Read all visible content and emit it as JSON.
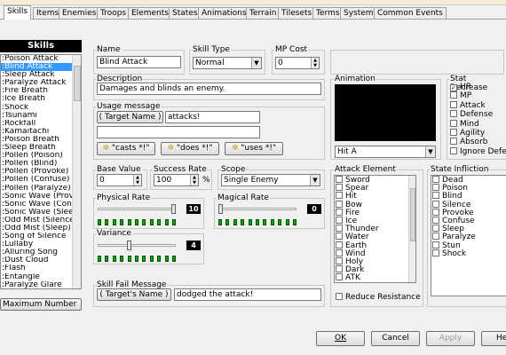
{
  "tabs": [
    "Skills",
    "Items",
    "Enemies",
    "Troops",
    "Elements",
    "States",
    "Animations",
    "Terrain",
    "Tilesets",
    "Terms",
    "System",
    "Common Events"
  ],
  "sidebar": {
    "header": "Skills",
    "items": [
      ":Poison Attack",
      ":Blind Attack",
      ":Sleep Attack",
      ":Paralyze Attack",
      ":Fire Breath",
      ":Ice Breath",
      ":Shock",
      ":Tsunami",
      ":Rockfall",
      ":Kamaitachi",
      ":Poison Breath",
      ":Sleep Breath",
      ":Pollen (Poison)",
      ":Pollen (Blind)",
      ":Pollen (Provoke)",
      ":Pollen (Confuse)",
      ":Pollen (Paralyze)",
      ":Sonic Wave (Provo",
      ":Sonic Wave (Confu",
      ":Sonic Wave (Sleep",
      ":Odd Mist (Silence)",
      ":Odd Mist (Sleep)",
      ":Song of Silence",
      ":Lullaby",
      ":Alluring Song",
      ":Dust Cloud",
      ":Flash",
      ":Entangle",
      ":Paralyze Glare"
    ],
    "selected_index": 1,
    "max_button": "Maximum Number"
  },
  "form": {
    "name_label": "Name",
    "name_value": "Blind Attack",
    "skill_type_label": "Skill Type",
    "skill_type_value": "Normal",
    "mp_cost_label": "MP Cost",
    "mp_cost_value": "0",
    "description_label": "Description",
    "description_value": "Damages and blinds an enemy.",
    "usage_label": "Usage message",
    "target_name_btn": "( Target Name )",
    "usage_line1": "attacks!",
    "usage_line2": "",
    "casts_btn": "\"casts *!\"",
    "does_btn": "\"does *!\"",
    "uses_btn": "\"uses *!\"",
    "base_value_label": "Base Value",
    "base_value": "0",
    "success_rate_label": "Success Rate",
    "success_rate": "100",
    "percent": "%",
    "scope_label": "Scope",
    "scope_value": "Single Enemy",
    "physical_rate_label": "Physical Rate",
    "physical_rate": "10",
    "magical_rate_label": "Magical Rate",
    "magical_rate": "0",
    "variance_label": "Variance",
    "variance": "4",
    "fail_label": "Skill Fail Message",
    "targets_name_btn": "( Target's Name )",
    "fail_value": "dodged the attack!",
    "animation_label": "Animation",
    "animation_value": "Hit A",
    "stat_label": "Stat Decrease",
    "stats": [
      {
        "label": "HP",
        "checked": true
      },
      {
        "label": "MP",
        "checked": false
      },
      {
        "label": "Attack",
        "checked": false
      },
      {
        "label": "Defense",
        "checked": false
      },
      {
        "label": "Mind",
        "checked": false
      },
      {
        "label": "Agility",
        "checked": false
      },
      {
        "label": "Absorb",
        "checked": false
      },
      {
        "label": "Ignore Defen",
        "checked": false
      }
    ],
    "attack_element_label": "Attack Element",
    "elements": [
      "Sword",
      "Spear",
      "Hit",
      "Bow",
      "Fire",
      "Ice",
      "Thunder",
      "Water",
      "Earth",
      "Wind",
      "Holy",
      "Dark",
      "ATK"
    ],
    "reduce_resistance": "Reduce Resistance",
    "state_infliction_label": "State Infliction",
    "states": [
      "Dead",
      "Poison",
      "Blind",
      "Silence",
      "Provoke",
      "Confuse",
      "Sleep",
      "Paralyze",
      "Stun",
      "Shock"
    ],
    "physical_rate_fraction": 1.0,
    "magical_rate_fraction": 0.0,
    "variance_fraction": 0.4
  },
  "footer": {
    "ok": "OK",
    "cancel": "Cancel",
    "apply": "Apply",
    "help": "He"
  },
  "colors": {
    "selection": "#3399ff",
    "animation_preview": "#000000",
    "slider_tick": "#00aa00"
  }
}
